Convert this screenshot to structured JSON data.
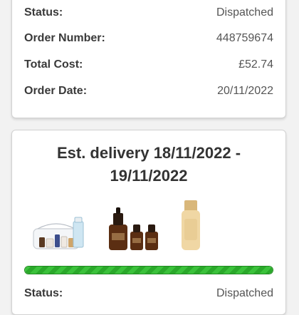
{
  "order": {
    "status_label": "Status:",
    "status_value": "Dispatched",
    "number_label": "Order Number:",
    "number_value": "448759674",
    "cost_label": "Total Cost:",
    "cost_value": "£52.74",
    "date_label": "Order Date:",
    "date_value": "20/11/2022"
  },
  "delivery": {
    "estimate": "Est. delivery 18/11/2022 - 19/11/2022",
    "progress_percent": 100,
    "progress_color": "#3bc23b",
    "status_label": "Status:",
    "status_value": "Dispatched",
    "products": [
      "gift-set-bag-image",
      "serum-bottles-image",
      "lotion-bottle-image"
    ]
  }
}
